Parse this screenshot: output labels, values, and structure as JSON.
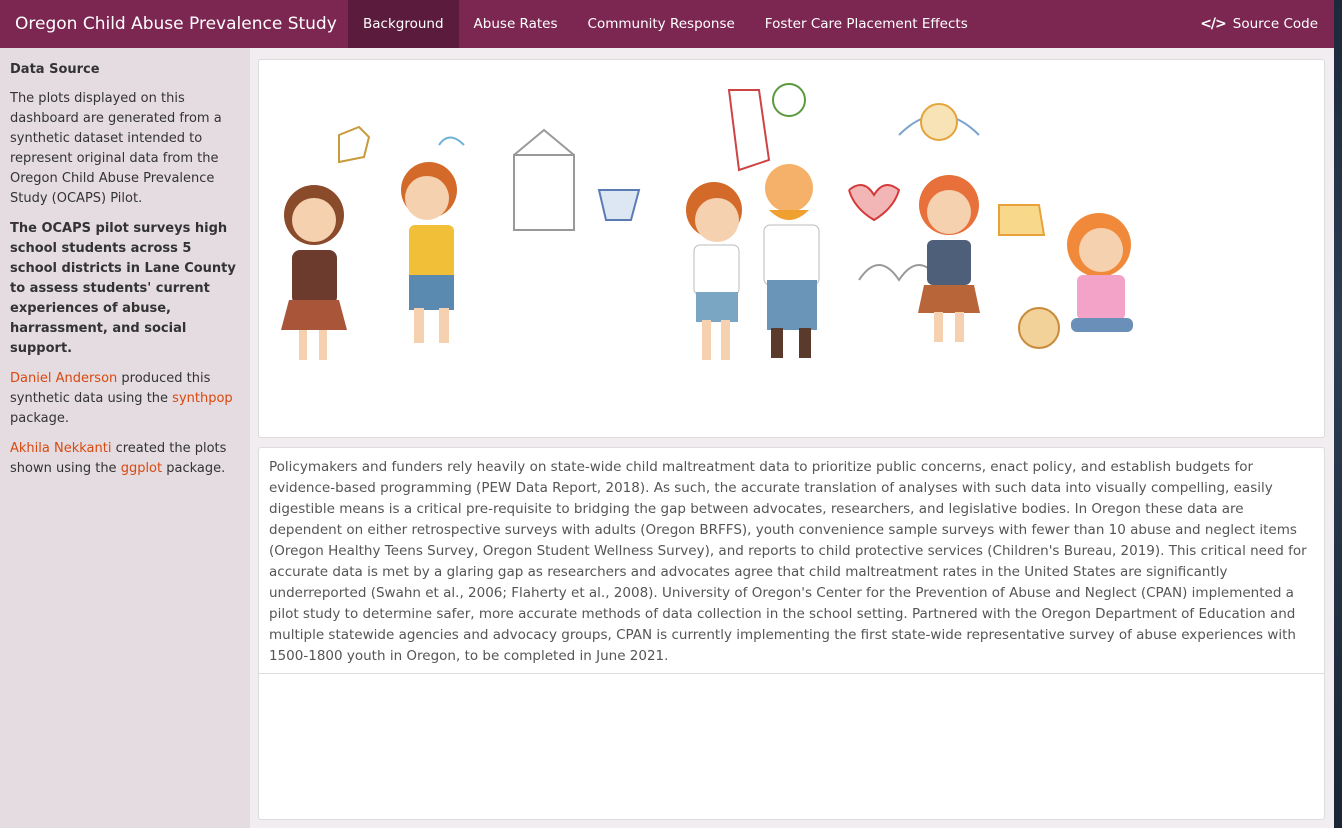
{
  "navbar": {
    "title": "Oregon Child Abuse Prevalence Study",
    "tabs": [
      {
        "label": "Background",
        "active": true
      },
      {
        "label": "Abuse Rates",
        "active": false
      },
      {
        "label": "Community Response",
        "active": false
      },
      {
        "label": "Foster Care Placement Effects",
        "active": false
      }
    ],
    "source_icon": "code-icon",
    "source_label": "Source Code"
  },
  "sidebar": {
    "title": "Data Source",
    "para1": "The plots displayed on this dashboard are generated from a synthetic dataset intended to represent original data from the Oregon Child Abuse Prevalence Study (OCAPS) Pilot.",
    "para2": "The OCAPS pilot surveys high school students across 5 school districts in Lane County to assess students' current experiences of abuse, harrassment, and social support.",
    "para3": {
      "link1": "Daniel Anderson",
      "text1": " produced this synthetic data using the ",
      "link2": "synthpop",
      "text2": " package."
    },
    "para4": {
      "link1": "Akhila Nekkanti",
      "text1": " created the plots shown using the ",
      "link2": "ggplot",
      "text2": " package."
    }
  },
  "main": {
    "image_caption": "children-drawing-illustration",
    "body_text": "Policymakers and funders rely heavily on state-wide child maltreatment data to prioritize public concerns, enact policy, and establish budgets for evidence-based programming (PEW Data Report, 2018). As such, the accurate translation of analyses with such data into visually compelling, easily digestible means is a critical pre-requisite to bridging the gap between advocates, researchers, and legislative bodies. In Oregon these data are dependent on either retrospective surveys with adults (Oregon BRFFS), youth convenience sample surveys with fewer than 10 abuse and neglect items (Oregon Healthy Teens Survey, Oregon Student Wellness Survey), and reports to child protective services (Children's Bureau, 2019). This critical need for accurate data is met by a glaring gap as researchers and advocates agree that child maltreatment rates in the United States are significantly underreported (Swahn et al., 2006; Flaherty et al., 2008). University of Oregon's Center for the Prevention of Abuse and Neglect (CPAN) implemented a pilot study to determine safer, more accurate methods of data collection in the school setting. Partnered with the Oregon Department of Education and multiple statewide agencies and advocacy groups, CPAN is currently implementing the first state-wide representative survey of abuse experiences with 1500-1800 youth in Oregon, to be completed in June 2021."
  },
  "colors": {
    "navbar": "#7c2752",
    "navbar_active": "#5a1b3c",
    "sidebar": "#e4dce1",
    "link": "#d9480f"
  }
}
